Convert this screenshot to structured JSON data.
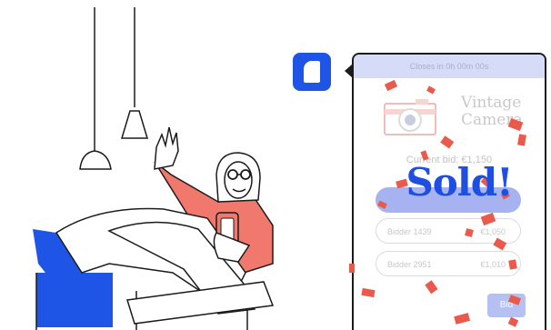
{
  "colors": {
    "accent": "#1f55e6",
    "sleeve": "#f0786c",
    "confetti": "#ea5a4c",
    "highlight": "#a6b3f0"
  },
  "auction": {
    "timer_text": "Closes in 0h 00m 00s",
    "product_name_line1": "Vintage",
    "product_name_line2": "Camera",
    "current_bid": "Current bid: €1,150",
    "bids": [
      {
        "bidder": "Bidder 1439",
        "amount": "€1,050"
      },
      {
        "bidder": "Bidder 2951",
        "amount": "€1,010"
      }
    ],
    "bid_button": "Bid",
    "sold_label": "Sold!"
  },
  "icons": {
    "chat_avatar": "chat-bubble-icon",
    "camera": "camera-icon"
  }
}
